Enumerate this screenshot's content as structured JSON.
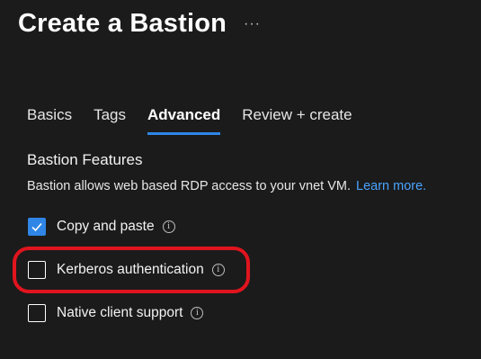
{
  "header": {
    "title": "Create a Bastion",
    "more_label": "···"
  },
  "tabs": [
    {
      "label": "Basics",
      "active": false
    },
    {
      "label": "Tags",
      "active": false
    },
    {
      "label": "Advanced",
      "active": true
    },
    {
      "label": "Review + create",
      "active": false
    }
  ],
  "section": {
    "title": "Bastion Features",
    "description": "Bastion allows web based RDP access to your vnet VM.",
    "learn_more": "Learn more."
  },
  "options": [
    {
      "label": "Copy and paste",
      "checked": true
    },
    {
      "label": "Kerberos authentication",
      "checked": false
    },
    {
      "label": "Native client support",
      "checked": false
    }
  ],
  "info_glyph": "i",
  "colors": {
    "background": "#1b1b1b",
    "accent": "#2f86e6",
    "link": "#4aa3ff",
    "highlight": "#e0141e"
  }
}
